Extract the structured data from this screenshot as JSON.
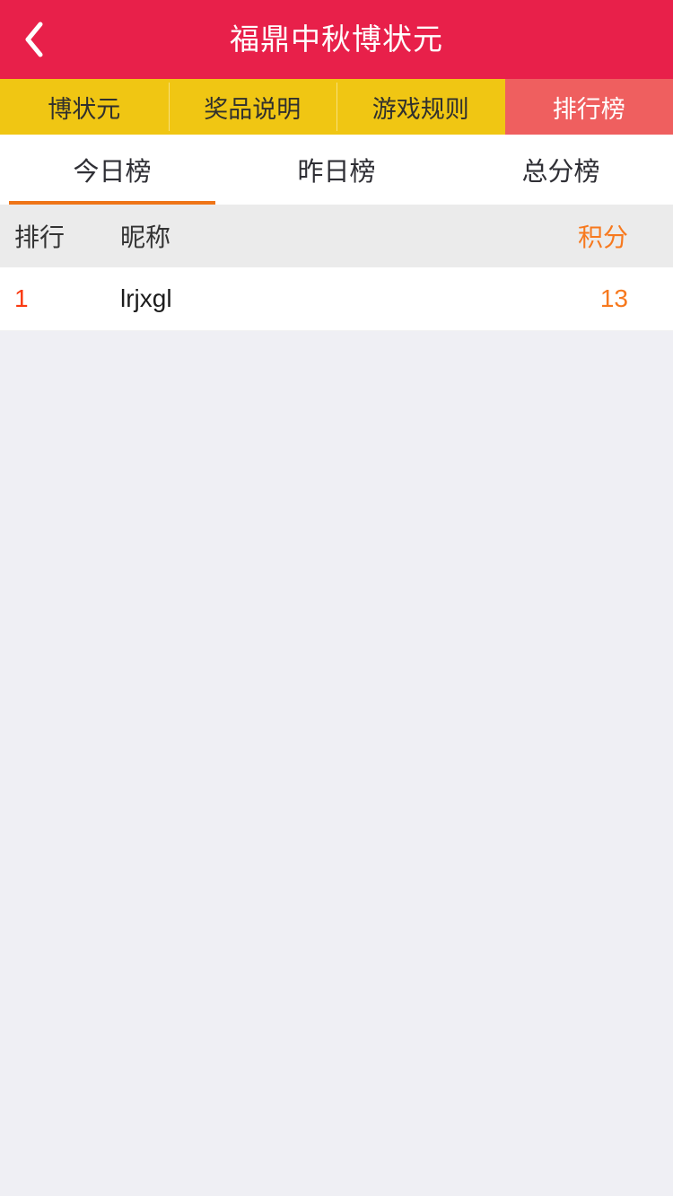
{
  "header": {
    "title": "福鼎中秋博状元",
    "back_icon": "chevron-left-icon",
    "background_color": "#e8204a",
    "text_color": "#ffffff"
  },
  "nav": {
    "background_color": "#f0c613",
    "active_color": "#ef5f5f",
    "tabs": [
      {
        "label": "博状元",
        "active": false
      },
      {
        "label": "奖品说明",
        "active": false
      },
      {
        "label": "游戏规则",
        "active": false
      },
      {
        "label": "排行榜",
        "active": true
      }
    ]
  },
  "subtabs": {
    "underline_color": "#ef7518",
    "items": [
      {
        "label": "今日榜",
        "active": true
      },
      {
        "label": "昨日榜",
        "active": false
      },
      {
        "label": "总分榜",
        "active": false
      }
    ]
  },
  "leaderboard": {
    "header_background": "#ebebeb",
    "score_color": "#f7791e",
    "rank_color": "#fa3a11",
    "columns": {
      "rank": "排行",
      "nickname": "昵称",
      "score": "积分"
    },
    "rows": [
      {
        "rank": "1",
        "nickname": "lrjxgl",
        "score": "13"
      }
    ]
  },
  "page": {
    "background_color": "#efeff4"
  }
}
